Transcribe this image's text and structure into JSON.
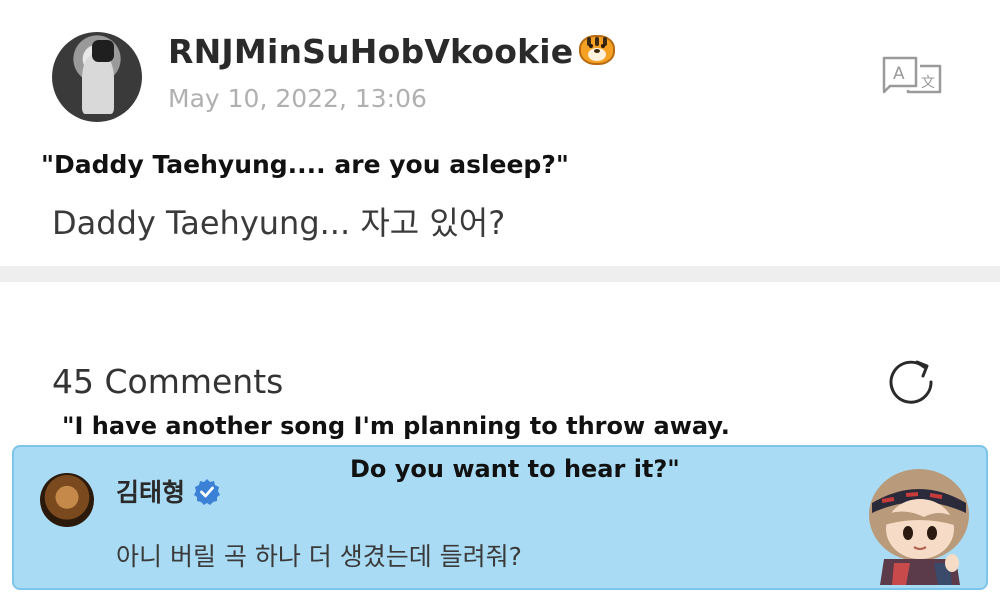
{
  "post": {
    "username": "RNJMinSuHobVkookie",
    "username_emoji": "tiger-face",
    "timestamp": "May 10, 2022, 13:06",
    "caption_translation": "\"Daddy Taehyung.... are you asleep?\"",
    "text": "Daddy Taehyung... 자고 있어?"
  },
  "comments": {
    "count_label": "45 Comments",
    "caption_translation_line1": "\"I have another song I'm planning to throw away.",
    "caption_translation_line2": "Do you want to hear it?\"",
    "items": [
      {
        "author": "김태형",
        "verified": true,
        "text": "아니 버릴 곡 하나 더 생겼는데 들려줘?"
      }
    ]
  },
  "colors": {
    "comment_highlight": "#a9dcf4",
    "verified_badge": "#3b82d6",
    "timestamp_gray": "#b0b0b0"
  }
}
